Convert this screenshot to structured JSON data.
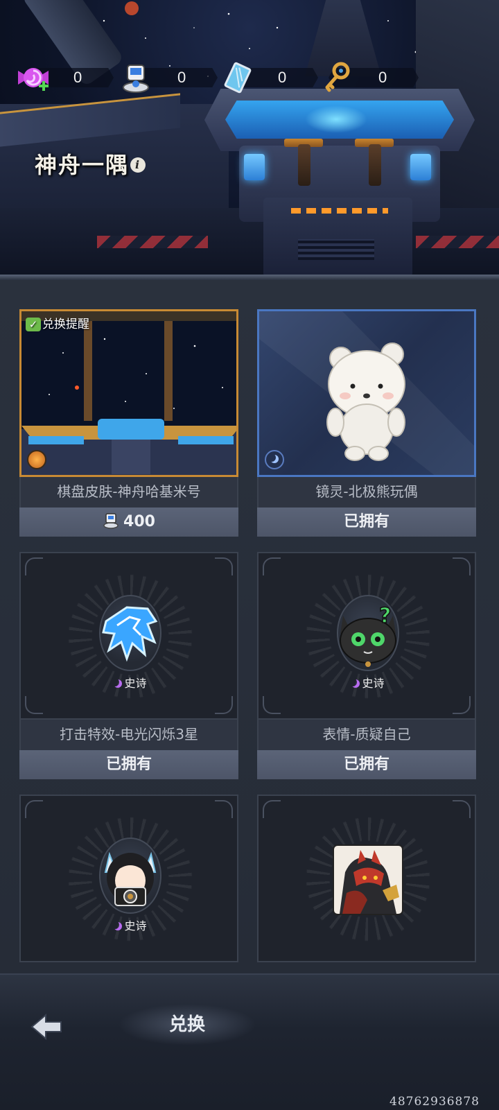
{
  "currencies": [
    {
      "name": "candy",
      "icon": "candy-icon",
      "value": "0"
    },
    {
      "name": "robot-token",
      "icon": "robot-token-icon",
      "value": "0"
    },
    {
      "name": "card",
      "icon": "card-ticket-icon",
      "value": "0"
    },
    {
      "name": "key",
      "icon": "gold-key-icon",
      "value": "0"
    }
  ],
  "header": {
    "title": "神舟一隅",
    "info_symbol": "i"
  },
  "items": [
    {
      "name": "棋盘皮肤-神舟哈基米号",
      "price": "400",
      "badge": "兑换提醒",
      "owned": false
    },
    {
      "name": "镜灵-北极熊玩偶",
      "price": "已拥有",
      "owned": true
    },
    {
      "name": "打击特效-电光闪烁3星",
      "rarity": "史诗",
      "price": "已拥有",
      "owned": true
    },
    {
      "name": "表情-质疑自己",
      "rarity": "史诗",
      "price": "已拥有",
      "owned": true
    },
    {
      "name": "",
      "rarity": "史诗"
    },
    {
      "name": ""
    }
  ],
  "bottom": {
    "tab_label": "兑换",
    "uid": "487629368​78"
  },
  "colors": {
    "accent_gold": "#c88a34",
    "accent_blue": "#4a77c2",
    "epic_purple": "#b86cf0"
  }
}
